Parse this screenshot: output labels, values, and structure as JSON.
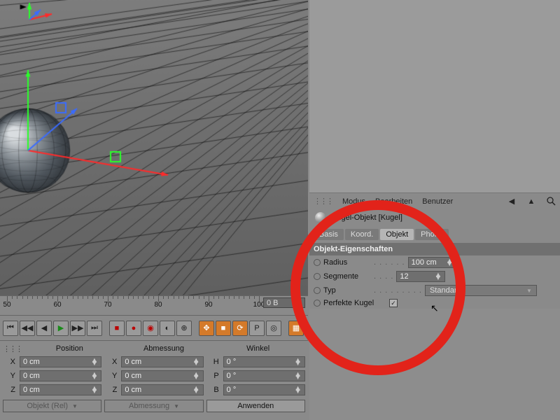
{
  "attr_menu": {
    "modus": "Modus",
    "bearbeiten": "Bearbeiten",
    "benutzer": "Benutzer"
  },
  "object_header": {
    "title": "Kugel-Objekt [Kugel]"
  },
  "tabs": {
    "basis": "Basis",
    "koord": "Koord.",
    "objekt": "Objekt",
    "phong": "Phong"
  },
  "section": {
    "title": "Objekt-Eigenschaften"
  },
  "props": {
    "radius_label": "Radius",
    "radius_value": "100 cm",
    "segmente_label": "Segmente",
    "segmente_value": "12",
    "typ_label": "Typ",
    "typ_value": "Standard",
    "perfekte_label": "Perfekte Kugel",
    "perfekte_checked": "✓"
  },
  "timeline": {
    "ticks": [
      "50",
      "60",
      "70",
      "80",
      "90",
      "100"
    ],
    "frame_field": "0 B"
  },
  "coord": {
    "col_position": "Position",
    "col_abmessung": "Abmessung",
    "col_winkel": "Winkel",
    "x_label": "X",
    "y_label": "Y",
    "z_label": "Z",
    "h_label": "H",
    "p_label": "P",
    "b_label": "B",
    "pos_x": "0 cm",
    "pos_y": "0 cm",
    "pos_z": "0 cm",
    "dim_x": "0 cm",
    "dim_y": "0 cm",
    "dim_z": "0 cm",
    "ang_h": "0 °",
    "ang_p": "0 °",
    "ang_b": "0 °",
    "mode_object": "Objekt (Rel)",
    "mode_dim": "Abmessung",
    "apply": "Anwenden"
  }
}
